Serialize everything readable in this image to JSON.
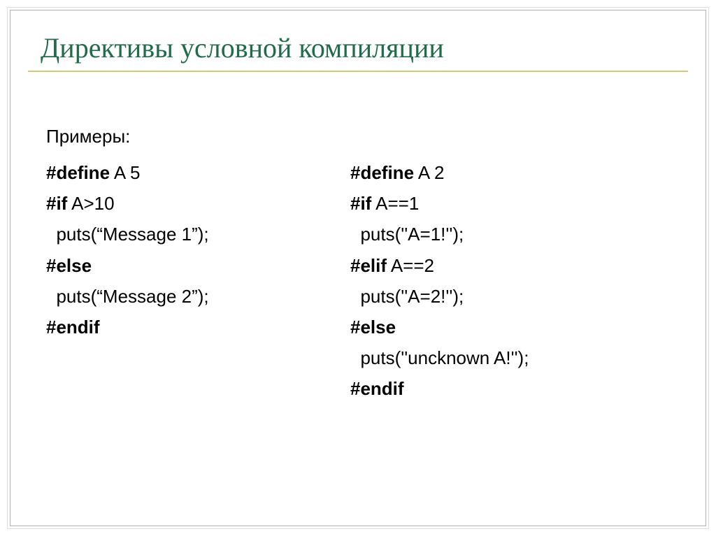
{
  "title": "Директивы условной компиляции",
  "intro": "Примеры:",
  "left": {
    "l1a": "#define",
    "l1b": " A 5",
    "l2a": "#if",
    "l2b": " A>10",
    "l3": "  puts(“Message 1”);",
    "l4a": "#else",
    "l5": "  puts(“Message 2”);",
    "l6a": "#endif"
  },
  "right": {
    "l1a": "#define",
    "l1b": " A 2",
    "l2a": "#if",
    "l2b": " A==1",
    "l3": "  puts(''A=1!'');",
    "l4a": "#elif",
    "l4b": " A==2",
    "l5": "  puts(''A=2!'');",
    "l6a": "#else",
    "l7": "  puts(''uncknown A!'');",
    "l8a": "#endif"
  }
}
